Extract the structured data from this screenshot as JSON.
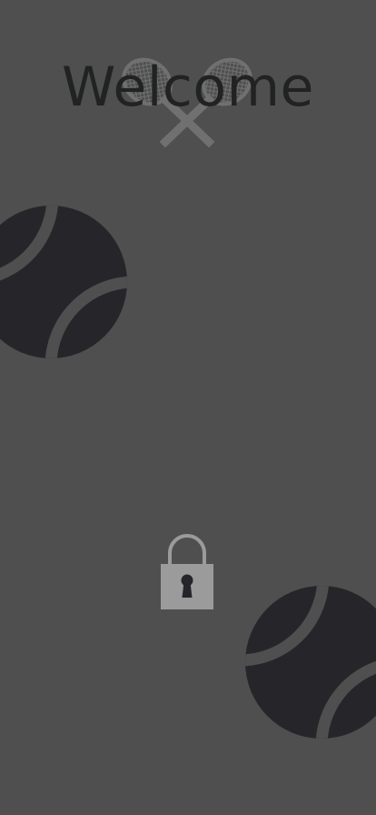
{
  "screen": {
    "title": "Welcome"
  },
  "icons": {
    "logo": "crossed-tennis-rackets-icon",
    "decor_ball_left": "tennis-ball-icon",
    "decor_ball_right": "tennis-ball-icon",
    "lock": "lock-icon"
  },
  "colors": {
    "background": "#4f4f4f",
    "title": "#202321",
    "ball": "#26262a",
    "lock": "#9b9b9b",
    "logo": "#8c8c8c"
  }
}
